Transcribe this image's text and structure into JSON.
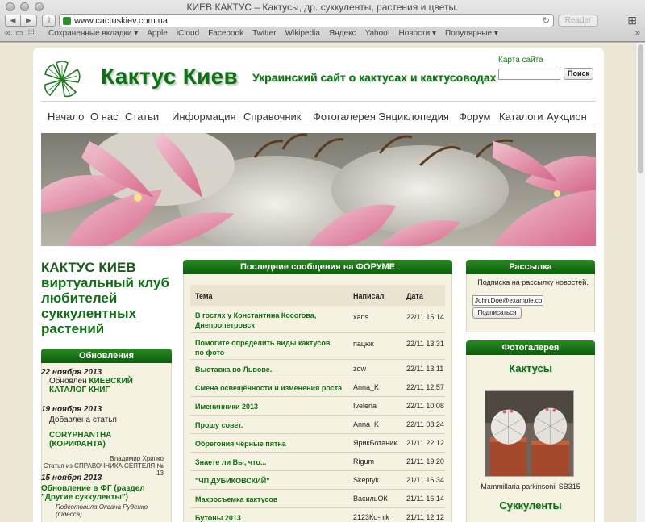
{
  "browser": {
    "window_title": "КИЕВ КАКТУС – Кактусы, др. суккуленты, растения и цветы.",
    "url": "www.cactuskiev.com.ua",
    "reader_label": "Reader",
    "bookmarks": [
      "Сохраненные вкладки ▾",
      "Apple",
      "iCloud",
      "Facebook",
      "Twitter",
      "Wikipedia",
      "Яндекс",
      "Yahoo!",
      "Новости ▾",
      "Популярные ▾"
    ]
  },
  "header": {
    "site_name": "Кактус Киев",
    "slogan": "Украинский сайт о кактусах и кактусоводах",
    "sitemap_link": "Карта сайта",
    "search_button": "Поиск"
  },
  "nav": {
    "items": [
      "Начало",
      "О нас",
      "Статьи",
      "Информация",
      "Справочник",
      "Фотогалерея",
      "Энциклопедия",
      "Форум",
      "Каталоги",
      "Аукцион"
    ]
  },
  "club": {
    "title_caps": "КАКТУС КИЕВ",
    "subtitle": "виртуальный клуб любителей суккулентных растений"
  },
  "updates": {
    "heading": "Обновления",
    "entries": [
      {
        "date": "22 ноября 2013",
        "text": "Обновлен",
        "link": "КИЕВСКИЙ КАТАЛОГ КНИГ"
      },
      {
        "date": "19 ноября 2013",
        "text": "Добавлена статья",
        "link": "CORYPHANTHA (КОРИФАНТА)",
        "author": "Владимир Хрипко",
        "source": "Статья из СПРАВОЧНИКА СЕЯТЕЛЯ № 13"
      },
      {
        "date": "15 ноября 2013",
        "link": "Обновление в ФГ (раздел \"Другие суккуленты\")",
        "author": "Подготовила Оксана Руденко (Одесса)"
      }
    ]
  },
  "forum": {
    "heading": "Последние сообщения на ФОРУМЕ",
    "columns": [
      "Тема",
      "Написал",
      "Дата"
    ],
    "rows": [
      {
        "topic": "В гостях у Константина Косогова, Днепропетровск",
        "author": "xans",
        "date": "22/11 15:14"
      },
      {
        "topic": "Помогите определить виды кактусов по фото",
        "author": "пацюк",
        "date": "22/11 13:31"
      },
      {
        "topic": "Выставка во Львове.",
        "author": "zow",
        "date": "22/11 13:11"
      },
      {
        "topic": "Смена освещённости и изменения роста",
        "author": "Anna_K",
        "date": "22/11 12:57"
      },
      {
        "topic": "Именинники 2013",
        "author": "Ivelena",
        "date": "22/11 10:08"
      },
      {
        "topic": "Прошу совет.",
        "author": "Anna_K",
        "date": "22/11 08:24"
      },
      {
        "topic": "Обрегония чёрные пятна",
        "author": "ЯрикБотаник",
        "date": "21/11 22:12"
      },
      {
        "topic": "Знаете ли Вы, что...",
        "author": "Rigum",
        "date": "21/11 19:20"
      },
      {
        "topic": "\"ЧП ДУБИКОВСКИЙ\"",
        "author": "Skeptyk",
        "date": "21/11 16:34"
      },
      {
        "topic": "Макросъемка кактусов",
        "author": "ВасильОК",
        "date": "21/11 16:14"
      },
      {
        "topic": "Бутоны 2013",
        "author": "2123Ко-nik",
        "date": "21/11 12:12"
      }
    ]
  },
  "newsletter": {
    "heading": "Рассылка",
    "text": "Подписка на рассылку новостей.",
    "email_value": "John.Doe@example.co",
    "subscribe_button": "Подписаться"
  },
  "gallery": {
    "heading": "Фотогалерея",
    "section1": "Кактусы",
    "caption": "Mammillaria parkinsonii SB315",
    "section2": "Суккуленты"
  },
  "colors": {
    "brand_green": "#0f6f14",
    "header_bar_green": "#1a7a1a",
    "page_bg": "#ebe7d4",
    "box_bg": "#f6f2e2"
  }
}
